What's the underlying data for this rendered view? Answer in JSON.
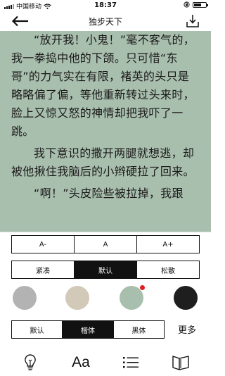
{
  "status_bar": {
    "carrier": "中国移动",
    "time": "18:37",
    "battery_level": 0.65
  },
  "nav": {
    "title": "独步天下"
  },
  "content": {
    "paragraphs": [
      "“放开我！小鬼！”毫不客气的，我一拳捣中他的下颌。只可惜“东哥”的力气实在有限，褚英的头只是略略偏了偏，等他重新转过头来时，脸上又惊又怒的神情却把我吓了一跳。",
      "我下意识的撒开两腿就想逃，却被他揪住我脑后的小辫硬拉了回来。",
      "“啊！”头皮险些被拉掉，我跟"
    ]
  },
  "settings": {
    "font_size": {
      "decrease": "A-",
      "current": "A",
      "increase": "A+"
    },
    "spacing": {
      "options": [
        "紧凑",
        "默认",
        "松散"
      ],
      "selected": "默认"
    },
    "backgrounds": [
      {
        "color": "#b3b3b3",
        "selected": false
      },
      {
        "color": "#d2c9b8",
        "selected": false
      },
      {
        "color": "#a9bfae",
        "selected": true
      },
      {
        "color": "#1e1e1e",
        "selected": false
      }
    ],
    "selected_dot_color": "#e02020",
    "fonts": {
      "options": [
        "默认",
        "楷体",
        "黑体"
      ],
      "selected": "楷体"
    },
    "more_label": "更多"
  },
  "toolbar": {
    "items": [
      {
        "icon": "lightbulb-icon"
      },
      {
        "icon": "font-icon",
        "label": "Aa"
      },
      {
        "icon": "list-icon"
      },
      {
        "icon": "book-icon"
      }
    ]
  }
}
